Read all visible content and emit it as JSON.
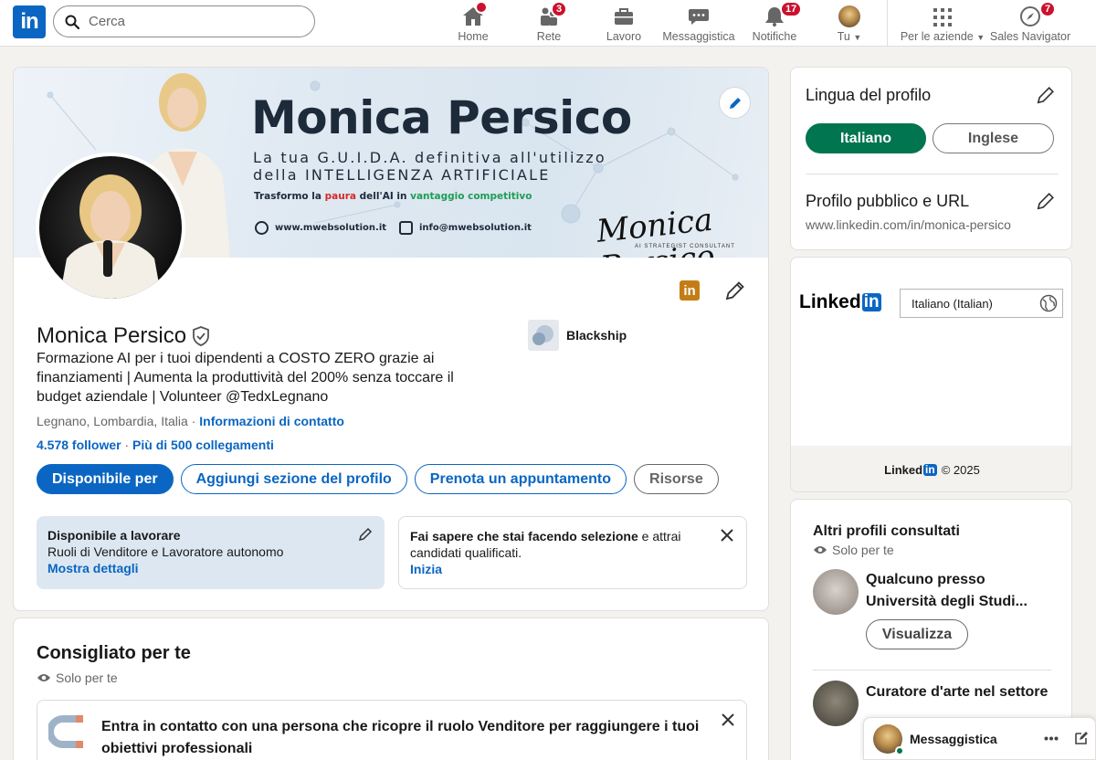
{
  "nav": {
    "search_placeholder": "Cerca",
    "items": [
      {
        "label": "Home",
        "badge": ""
      },
      {
        "label": "Rete",
        "badge": "3"
      },
      {
        "label": "Lavoro",
        "badge": ""
      },
      {
        "label": "Messaggistica",
        "badge": ""
      },
      {
        "label": "Notifiche",
        "badge": "17"
      },
      {
        "label": "Tu",
        "badge": ""
      },
      {
        "label": "Per le aziende",
        "badge": ""
      },
      {
        "label": "Sales Navigator",
        "badge": "7"
      }
    ]
  },
  "banner": {
    "name": "Monica Persico",
    "tagline1": "La tua G.U.I.D.A. definitiva all'utilizzo",
    "tagline2": "della INTELLIGENZA ARTIFICIALE",
    "sub_a": "Trasformo la ",
    "sub_b": "paura",
    "sub_c": " dell'AI in ",
    "sub_d": "vantaggio competitivo",
    "website": "www.mwebsolution.it",
    "email": "info@mwebsolution.it",
    "signature": "Monica Persico",
    "signature_sub": "AI STRATEGIST   CONSULTANT"
  },
  "profile": {
    "name": "Monica Persico",
    "headline": "Formazione AI per i tuoi dipendenti a COSTO ZERO grazie ai finanziamenti | Aumenta la produttività del 200% senza toccare il budget aziendale | Volunteer @TedxLegnano",
    "location": "Legnano, Lombardia, Italia",
    "location_sep": " · ",
    "contact_info": "Informazioni di contatto",
    "followers": "4.578 follower",
    "conn_sep": " · ",
    "connections": "Più di 500 collegamenti",
    "company": "Blackship",
    "buttons": {
      "open_to": "Disponibile per",
      "add_section": "Aggiungi sezione del profilo",
      "book": "Prenota un appuntamento",
      "resources": "Risorse"
    },
    "open_to_work": {
      "title": "Disponibile a lavorare",
      "roles": "Ruoli di Venditore e Lavoratore autonomo",
      "details": "Mostra dettagli"
    },
    "hiring": {
      "bold": "Fai sapere che stai facendo selezione",
      "rest": " e attrai candidati qualificati.",
      "cta": "Inizia"
    }
  },
  "recommended": {
    "title": "Consigliato per te",
    "sub": "Solo per te",
    "text": "Entra in contatto con una persona che ricopre il ruolo Venditore per raggiungere i tuoi obiettivi professionali"
  },
  "right": {
    "profile_lang_title": "Lingua del profilo",
    "lang_active": "Italiano",
    "lang_other": "Inglese",
    "public_title": "Profilo pubblico e URL",
    "public_url": "www.linkedin.com/in/monica-persico",
    "ad_brand": "Linked",
    "ad_brand_in": "in",
    "ad_lang_select": "Italiano (Italian)",
    "ad_footer_brand": "Linked",
    "ad_footer_in": "in",
    "ad_footer_copy": "© 2025",
    "others_title": "Altri profili consultati",
    "others_sub": "Solo per te",
    "person1": "Qualcuno presso Università degli Studi...",
    "person1_btn": "Visualizza",
    "person2": "Curatore d'arte nel settore"
  },
  "messaging": {
    "title": "Messaggistica"
  },
  "colors": {
    "brand": "#0a66c2",
    "badge": "#cb112d",
    "lang_active": "#01754f"
  }
}
